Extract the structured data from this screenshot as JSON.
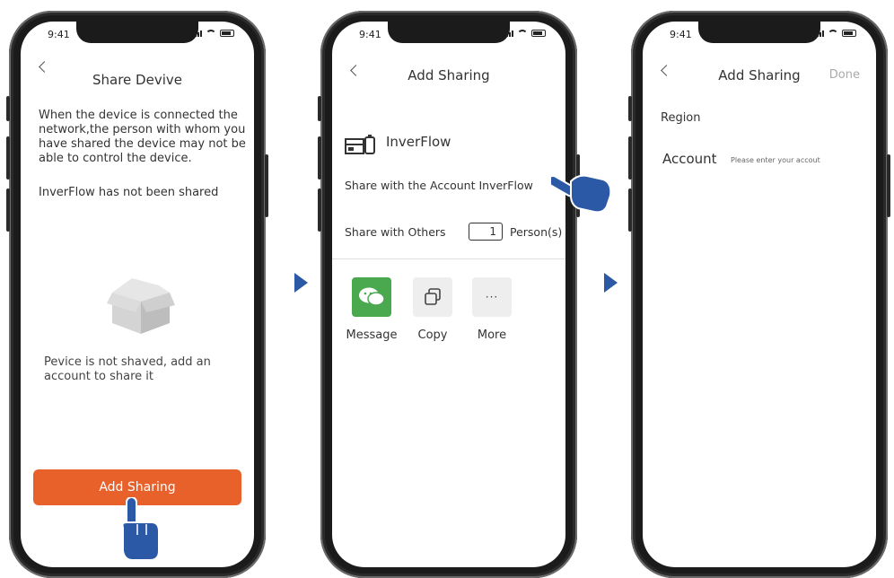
{
  "status_bar": {
    "time": "9:41"
  },
  "screen1": {
    "title": "Share Devive",
    "description": "When the device is connected the network,the person with whom you have shared the device may not be able to control the device.",
    "not_shared": "InverFlow has not been shared",
    "empty_text": "Pevice is not shaved, add an account to share it",
    "add_button": "Add Sharing",
    "button_color": "#e8602a"
  },
  "screen2": {
    "title": "Add Sharing",
    "device_name": "InverFlow",
    "share_account": "Share with the Account InverFlow",
    "share_others": "Share with Others",
    "persons_count": "1",
    "persons_label": "Person(s)",
    "share_options": [
      {
        "label": "Message",
        "icon": "message-icon"
      },
      {
        "label": "Copy",
        "icon": "copy-icon"
      },
      {
        "label": "More",
        "icon": "more-icon"
      }
    ]
  },
  "screen3": {
    "title": "Add Sharing",
    "done": "Done",
    "region_label": "Region",
    "account_label": "Account",
    "account_placeholder": "Please enter your accout"
  },
  "colors": {
    "accent": "#e8602a",
    "arrow": "#2b59a6",
    "hand": "#2b59a6",
    "message": "#4aa84f"
  }
}
